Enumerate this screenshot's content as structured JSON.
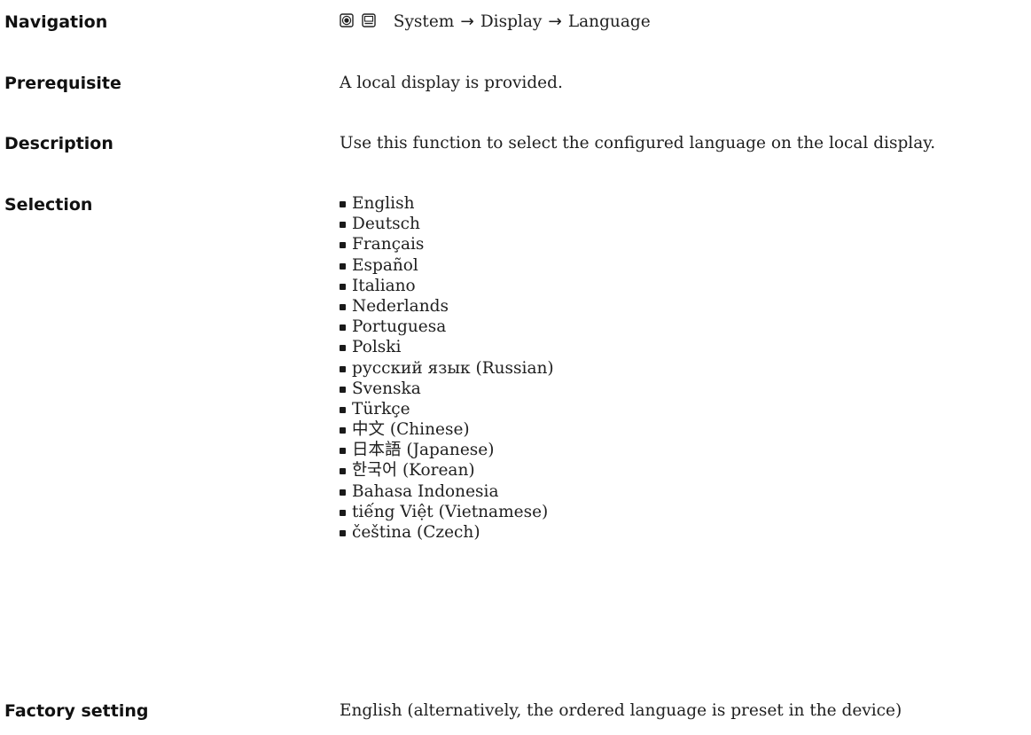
{
  "navigation": {
    "label": "Navigation",
    "icons": [
      "operating-menu-icon",
      "expert-menu-icon"
    ],
    "path": [
      "System",
      "Display",
      "Language"
    ],
    "separator": "→"
  },
  "prerequisite": {
    "label": "Prerequisite",
    "text": "A local display is provided."
  },
  "description": {
    "label": "Description",
    "text": "Use this function to select the configured language on the local display."
  },
  "selection": {
    "label": "Selection",
    "items": [
      "English",
      "Deutsch",
      "Français",
      "Español",
      "Italiano",
      "Nederlands",
      "Portuguesa",
      "Polski",
      "русский язык (Russian)",
      "Svenska",
      "Türkçe",
      "中文 (Chinese)",
      "日本語 (Japanese)",
      "한국어 (Korean)",
      "Bahasa Indonesia",
      "tiếng Việt (Vietnamese)",
      "čeština (Czech)"
    ]
  },
  "factory_setting": {
    "label": "Factory setting",
    "text": "English (alternatively, the ordered language is preset in the device)"
  }
}
